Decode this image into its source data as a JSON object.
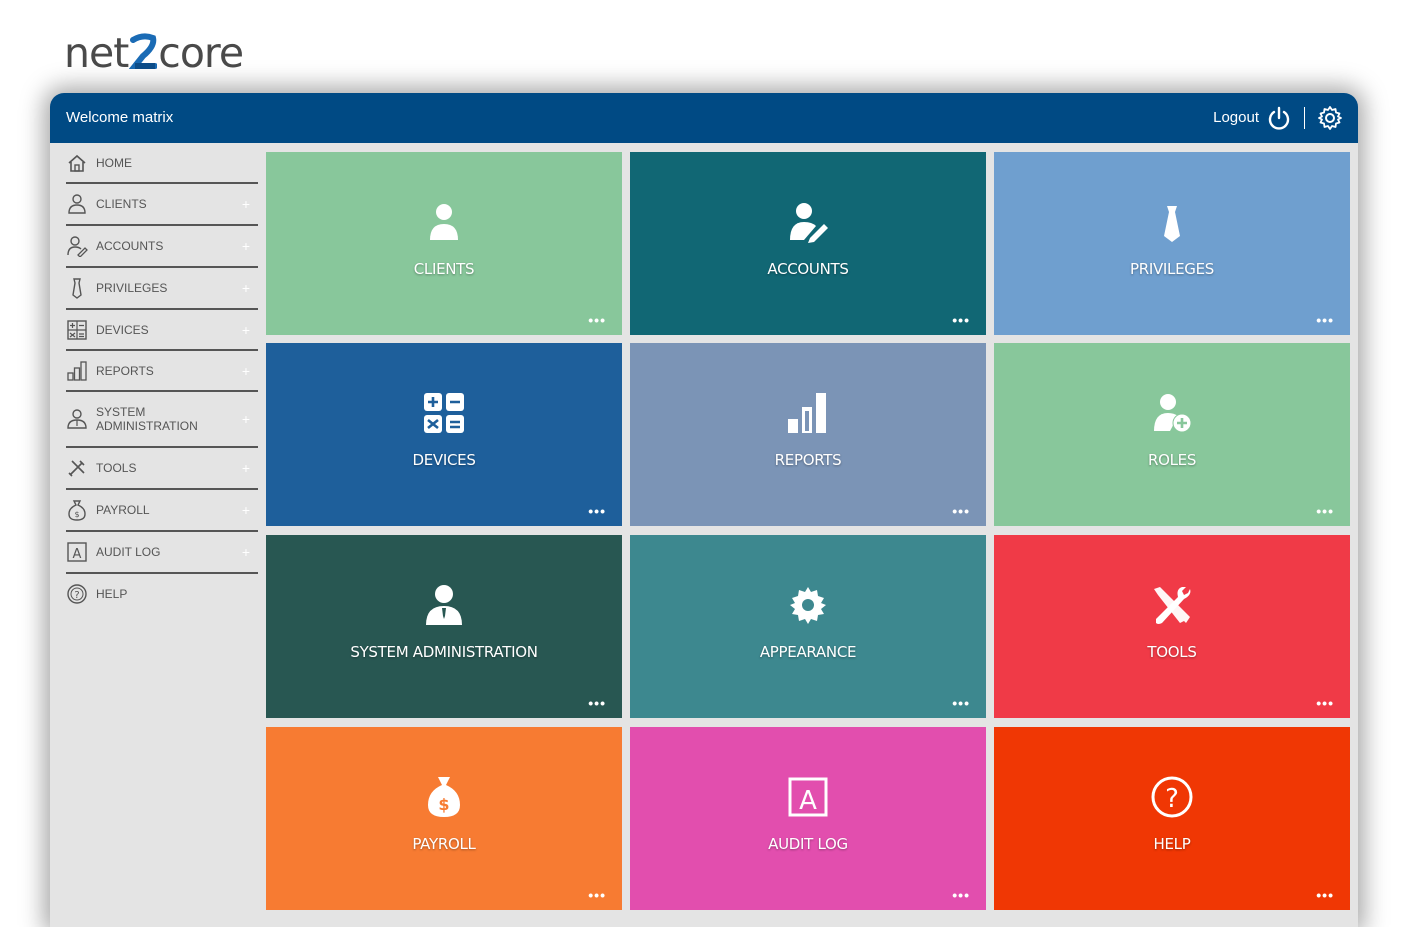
{
  "brand": {
    "text_left": "net",
    "text_right": "core"
  },
  "header": {
    "welcome": "Welcome matrix",
    "logout": "Logout",
    "color": "#004a84"
  },
  "sidebar": {
    "items": [
      {
        "label": "HOME",
        "icon": "home-icon",
        "plus": ""
      },
      {
        "label": "CLIENTS",
        "icon": "user-icon",
        "plus": "+"
      },
      {
        "label": "ACCOUNTS",
        "icon": "user-edit-icon",
        "plus": "+"
      },
      {
        "label": "PRIVILEGES",
        "icon": "tie-icon",
        "plus": "+"
      },
      {
        "label": "DEVICES",
        "icon": "calculator-icon",
        "plus": "+"
      },
      {
        "label": "REPORTS",
        "icon": "bar-chart-icon",
        "plus": "+"
      },
      {
        "label": "SYSTEM ADMINISTRATION",
        "icon": "admin-icon",
        "plus": "+"
      },
      {
        "label": "TOOLS",
        "icon": "tools-icon",
        "plus": "+"
      },
      {
        "label": "PAYROLL",
        "icon": "money-bag-icon",
        "plus": "+"
      },
      {
        "label": "AUDIT LOG",
        "icon": "audit-icon",
        "plus": "+"
      },
      {
        "label": "HELP",
        "icon": "help-icon",
        "plus": ""
      }
    ]
  },
  "tiles": [
    {
      "label": "CLIENTS",
      "color": "#88c79b",
      "icon": "user-icon",
      "more": "•••"
    },
    {
      "label": "ACCOUNTS",
      "color": "#116774",
      "icon": "user-edit-icon",
      "more": "•••"
    },
    {
      "label": "PRIVILEGES",
      "color": "#6f9fcf",
      "icon": "tie-icon",
      "more": "•••"
    },
    {
      "label": "DEVICES",
      "color": "#1e5f9b",
      "icon": "calculator-icon",
      "more": "•••"
    },
    {
      "label": "REPORTS",
      "color": "#7b94b6",
      "icon": "bar-chart-icon",
      "more": "•••"
    },
    {
      "label": "ROLES",
      "color": "#88c79b",
      "icon": "user-add-icon",
      "more": "•••"
    },
    {
      "label": "SYSTEM ADMINISTRATION",
      "color": "#285752",
      "icon": "admin-icon",
      "more": "•••"
    },
    {
      "label": "APPEARANCE",
      "color": "#3d888f",
      "icon": "gear-icon",
      "more": "•••"
    },
    {
      "label": "TOOLS",
      "color": "#f03a47",
      "icon": "tools-icon",
      "more": "•••"
    },
    {
      "label": "PAYROLL",
      "color": "#f77b32",
      "icon": "money-bag-icon",
      "more": "•••"
    },
    {
      "label": "AUDIT LOG",
      "color": "#e24eae",
      "icon": "audit-icon",
      "more": "•••"
    },
    {
      "label": "HELP",
      "color": "#f03704",
      "icon": "help-icon",
      "more": "•••"
    }
  ]
}
